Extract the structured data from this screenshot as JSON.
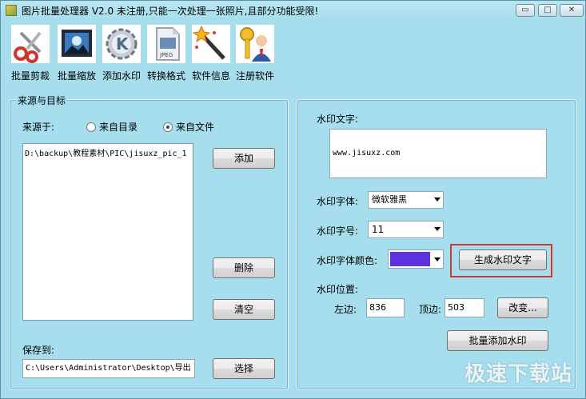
{
  "window": {
    "title": "图片批量处理器 V2.0   未注册,只能一次处理一张照片,且部分功能受限!",
    "minimize_glyph": "▭",
    "maximize_glyph": "□",
    "close_glyph": "✕"
  },
  "toolbar": {
    "items": [
      {
        "label": "批量剪裁",
        "icon": "scissors-icon"
      },
      {
        "label": "批量缩放",
        "icon": "picture-icon"
      },
      {
        "label": "添加水印",
        "icon": "kde-gear-icon"
      },
      {
        "label": "转换格式",
        "icon": "jpeg-file-icon"
      },
      {
        "label": "软件信息",
        "icon": "magic-wand-icon"
      },
      {
        "label": "注册软件",
        "icon": "keys-user-icon"
      }
    ]
  },
  "source_group": {
    "title": "来源与目标",
    "source_label": "来源于:",
    "radio_dir": "来自目录",
    "radio_file": "来自文件",
    "selected": "来自文件",
    "files": [
      "D:\\backup\\教程素材\\PIC\\jisuxz_pic_1"
    ],
    "add_button": "添加",
    "delete_button": "删除",
    "clear_button": "清空",
    "save_label": "保存到:",
    "save_path": "C:\\Users\\Administrator\\Desktop\\导出",
    "choose_button": "选择"
  },
  "watermark_group": {
    "text_label": "水印文字:",
    "text_value": "www.jisuxz.com",
    "font_label": "水印字体:",
    "font_value": "微软雅黑",
    "size_label": "水印字号:",
    "size_value": "11",
    "color_label": "水印字体颜色:",
    "color_value": "#5b34e0",
    "generate_button": "生成水印文字",
    "position_label": "水印位置:",
    "left_label": "左边:",
    "left_value": "836",
    "top_label": "顶边:",
    "top_value": "503",
    "change_button": "改变...",
    "batch_button": "批量添加水印"
  },
  "brand_watermark": "极速下载站"
}
